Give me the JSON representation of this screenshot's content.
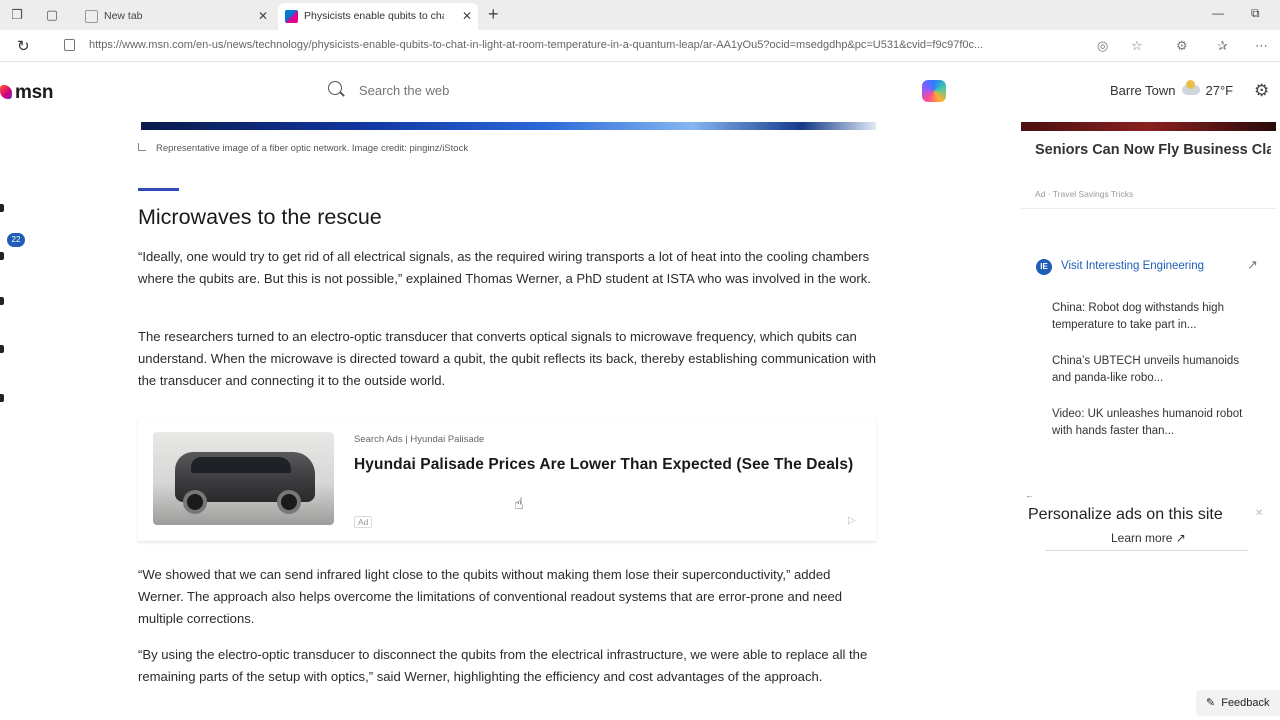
{
  "browser": {
    "tabs": [
      {
        "label": "New tab",
        "active": false
      },
      {
        "label": "Physicists enable qubits to chat",
        "active": true
      }
    ],
    "url": "https://www.msn.com/en-us/news/technology/physicists-enable-qubits-to-chat-in-light-at-room-temperature-in-a-quantum-leap/ar-AA1yOu5?ocid=msedgdhp&pc=U531&cvid=f9c97f0c..."
  },
  "header": {
    "logo": "msn",
    "search_placeholder": "Search the web",
    "location": "Barre Town",
    "temperature": "27°F"
  },
  "rail": {
    "badge": "22"
  },
  "article": {
    "caption": "Representative image of a fiber optic network. Image credit: pinginz/iStock",
    "heading": "Microwaves to the rescue",
    "paragraphs": [
      "“Ideally, one would try to get rid of all electrical signals, as the required wiring transports a lot of heat into the cooling chambers where the qubits are. But this is not possible,” explained Thomas Werner, a PhD student at ISTA who was involved in the work.",
      "The researchers turned to an electro-optic transducer that converts optical signals to microwave frequency, which qubits can understand. When the microwave is directed toward a qubit, the qubit reflects its back, thereby establishing communication with the transducer and connecting it to the outside world.",
      "“We showed that we can send infrared light close to the qubits without making them lose their superconductivity,” added Werner. The approach also helps overcome the limitations of conventional readout systems that are error-prone and need multiple corrections.",
      "“By using the electro-optic transducer to disconnect the qubits from the electrical infrastructure, we were able to replace all the remaining parts of the setup with optics,” said Werner, highlighting the efficiency and cost advantages of the approach."
    ],
    "ad": {
      "source": "Search Ads | Hyundai Palisade",
      "title": "Hyundai Palisade Prices Are Lower Than Expected (See The Deals)",
      "label": "Ad"
    }
  },
  "sidebar": {
    "promo": {
      "title": "Seniors Can Now Fly Business Class For The Price Of Econom...",
      "ad": "Ad · Travel Savings Tricks"
    },
    "source": {
      "logo": "IE",
      "link": "Visit Interesting Engineering",
      "items": [
        "China: Robot dog withstands high temperature to take part in...",
        "China’s UBTECH unveils humanoids and panda-like robo...",
        "Video: UK unleashes humanoid robot with hands faster than..."
      ]
    },
    "personalize": {
      "title": "Personalize ads on this site",
      "learn_more": "Learn more"
    }
  },
  "feedback_label": "Feedback"
}
